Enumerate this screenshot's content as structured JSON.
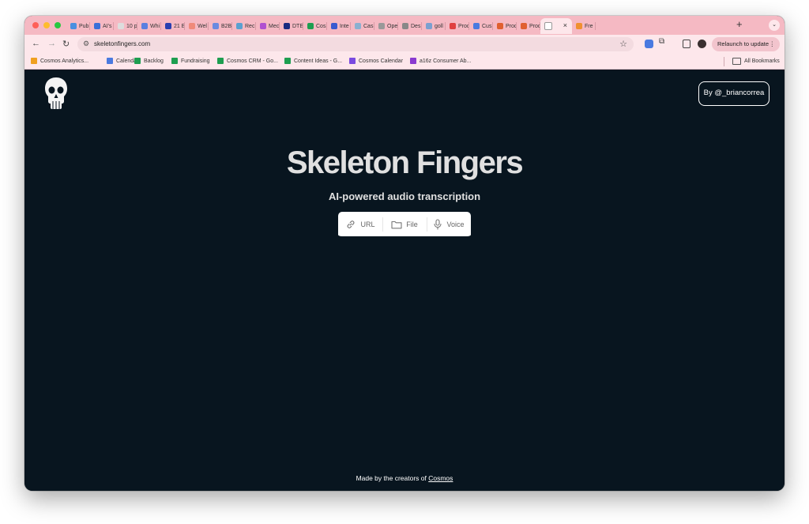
{
  "browser": {
    "tabs": [
      {
        "label": "Pub",
        "color": "#4a8fe0"
      },
      {
        "label": "AI's",
        "color": "#3a6fd8"
      },
      {
        "label": "10 p",
        "color": "#dddddd"
      },
      {
        "label": "Whi",
        "color": "#5b7fe0"
      },
      {
        "label": "21 E",
        "color": "#2a3fb0"
      },
      {
        "label": "Wel",
        "color": "#f08a7a"
      },
      {
        "label": "B2B",
        "color": "#6a8ae0"
      },
      {
        "label": "Rec",
        "color": "#5aa0d0"
      },
      {
        "label": "Mec",
        "color": "#b050d0"
      },
      {
        "label": "DTE",
        "color": "#1a2a80"
      },
      {
        "label": "Cos",
        "color": "#1e9e50"
      },
      {
        "label": "Inte",
        "color": "#3a5ad0"
      },
      {
        "label": "Cas",
        "color": "#8ab0d0"
      },
      {
        "label": "Ope",
        "color": "#999999"
      },
      {
        "label": "Des",
        "color": "#888888"
      },
      {
        "label": "goll",
        "color": "#7aa0d0"
      },
      {
        "label": "Prod",
        "color": "#e04040"
      },
      {
        "label": "Cus",
        "color": "#4a7ae0"
      },
      {
        "label": "Prod",
        "color": "#e06030"
      },
      {
        "label": "Prod",
        "color": "#e06030"
      }
    ],
    "active_tab": {
      "label": "",
      "close_icon": "×"
    },
    "last_tab": {
      "label": "Fre",
      "color": "#f09030"
    },
    "new_tab_label": "+",
    "tab_menu_label": "⌄",
    "url": "skeletonfingers.com",
    "relaunch_label": "Relaunch to update",
    "bookmarks": [
      {
        "label": "Cosmos Analytics...",
        "color": "#f0a020"
      },
      {
        "label": "Calendar",
        "color": "#4a7ae0"
      },
      {
        "label": "Backlog",
        "color": "#1e9e50"
      },
      {
        "label": "Fundraising",
        "color": "#1e9e50"
      },
      {
        "label": "Cosmos CRM - Go...",
        "color": "#1e9e50"
      },
      {
        "label": "Content Ideas - G...",
        "color": "#1e9e50"
      },
      {
        "label": "Cosmos Calendar",
        "color": "#7a4ae0"
      },
      {
        "label": "a16z Consumer Ab...",
        "color": "#8a3ad0"
      }
    ],
    "all_bookmarks_label": "All Bookmarks"
  },
  "page": {
    "byline": "By @_briancorrea",
    "title": "Skeleton Fingers",
    "subtitle": "AI-powered audio transcription",
    "modes": [
      {
        "label": "URL",
        "icon": "link-icon"
      },
      {
        "label": "File",
        "icon": "folder-icon"
      },
      {
        "label": "Voice",
        "icon": "microphone-icon"
      }
    ],
    "footer_text": "Made by the creators of",
    "footer_link": "Cosmos"
  }
}
